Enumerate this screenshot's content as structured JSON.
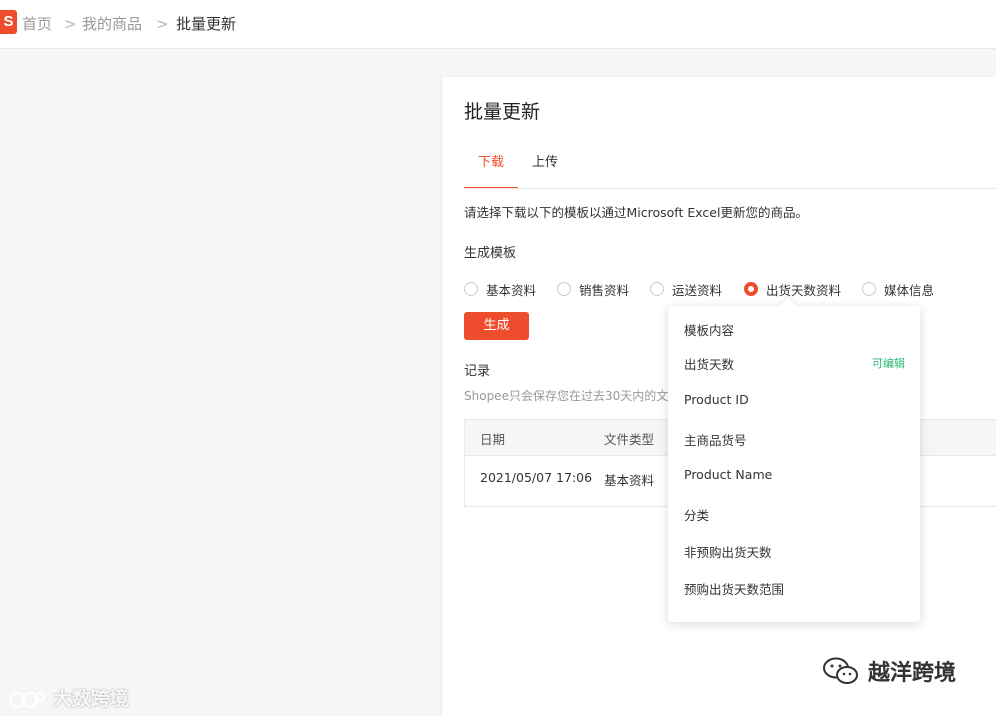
{
  "breadcrumb": {
    "logo": "S",
    "home": "首页",
    "products": "我的商品",
    "current": "批量更新",
    "separator": ">"
  },
  "page": {
    "title": "批量更新",
    "tabs": [
      {
        "label": "下载",
        "active": true
      },
      {
        "label": "上传",
        "active": false
      }
    ],
    "description": "请选择下载以下的模板以通过Microsoft Excel更新您的商品。",
    "template_section": "生成模板",
    "template_options": [
      {
        "label": "基本资料",
        "checked": false
      },
      {
        "label": "销售资料",
        "checked": false
      },
      {
        "label": "运送资料",
        "checked": false
      },
      {
        "label": "出货天数资料",
        "checked": true
      },
      {
        "label": "媒体信息",
        "checked": false
      }
    ],
    "generate_label": "生成",
    "records_title": "记录",
    "records_note": "Shopee只会保存您在过去30天内的文",
    "table": {
      "headers": [
        "日期",
        "文件类型"
      ],
      "rows": [
        [
          "2021/05/07 17:06",
          "基本资料"
        ]
      ]
    }
  },
  "popover": {
    "title": "模板内容",
    "editable_label": "可编辑",
    "fields": [
      "出货天数",
      "Product ID",
      "主商品货号",
      "Product Name",
      "分类",
      "非预购出货天数",
      "预购出货天数范围"
    ]
  },
  "watermarks": {
    "left": "大数跨境",
    "right": "越洋跨境"
  },
  "colors": {
    "accent": "#ee4d2d",
    "editable": "#2bb673"
  }
}
